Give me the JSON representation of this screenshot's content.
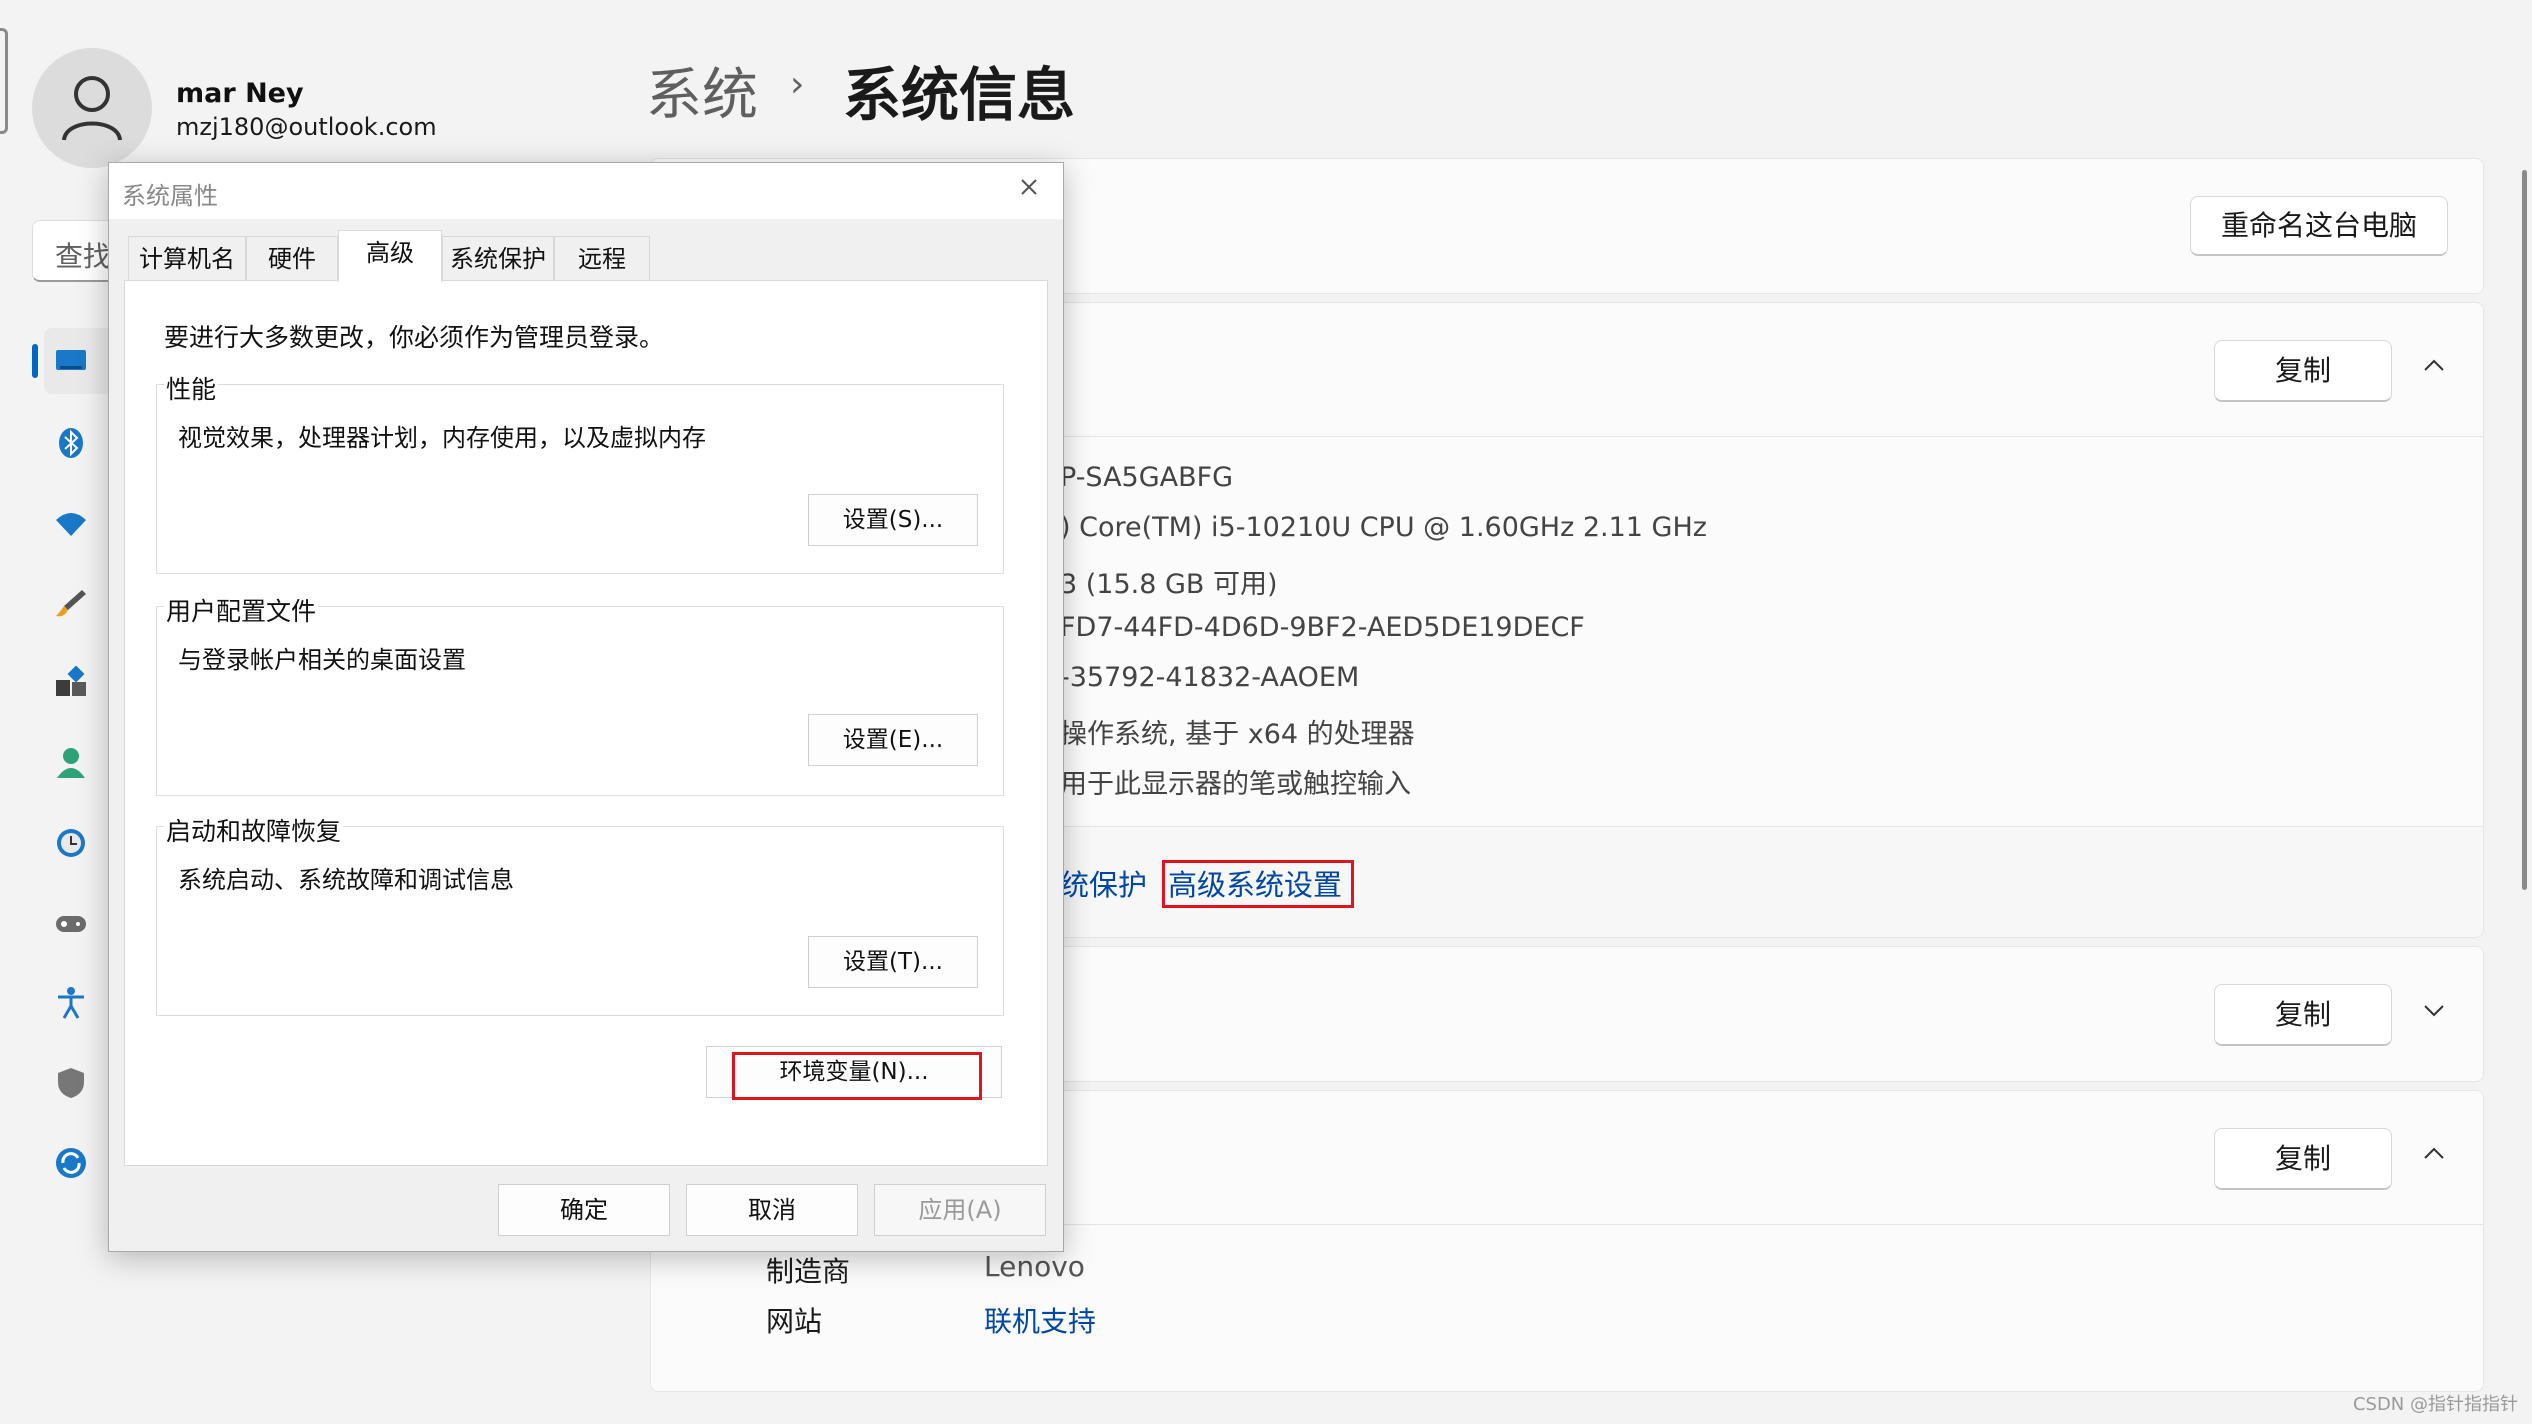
{
  "user": {
    "name": "mar Ney",
    "email": "mzj180@outlook.com"
  },
  "breadcrumb": {
    "root": "系统",
    "separator": "›",
    "current": "系统信息"
  },
  "search": {
    "placeholder": "查找"
  },
  "nav_icons": [
    "display-icon",
    "bluetooth-icon",
    "wifi-icon",
    "brush-icon",
    "apps-icon",
    "person-icon",
    "clock-globe-icon",
    "gamepad-icon",
    "accessibility-icon",
    "shield-icon",
    "update-icon"
  ],
  "rename_card": {
    "button": "重命名这台电脑"
  },
  "device_card": {
    "copy_button": "复制",
    "specs": [
      "P-SA5GABFG",
      ") Core(TM) i5-10210U CPU @ 1.60GHz   2.11 GHz",
      "3 (15.8 GB 可用)",
      "FD7-44FD-4D6D-9BF2-AED5DE19DECF",
      "-35792-41832-AAOEM",
      "操作系统, 基于 x64 的处理器",
      "用于此显示器的笔或触控输入"
    ],
    "links": {
      "protection": "统保护",
      "advanced": "高级系统设置"
    }
  },
  "windows_card": {
    "copy_button": "复制"
  },
  "support_card": {
    "copy_button": "复制",
    "rows": [
      {
        "label": "制造商",
        "value": "Lenovo"
      },
      {
        "label": "网站",
        "value": "联机支持"
      }
    ]
  },
  "dialog": {
    "title": "系统属性",
    "tabs": [
      "计算机名",
      "硬件",
      "高级",
      "系统保护",
      "远程"
    ],
    "admin_note": "要进行大多数更改，你必须作为管理员登录。",
    "groups": {
      "performance": {
        "title": "性能",
        "description": "视觉效果，处理器计划，内存使用，以及虚拟内存",
        "button": "设置(S)..."
      },
      "profile": {
        "title": "用户配置文件",
        "description": "与登录帐户相关的桌面设置",
        "button": "设置(E)..."
      },
      "startup": {
        "title": "启动和故障恢复",
        "description": "系统启动、系统故障和调试信息",
        "button": "设置(T)..."
      }
    },
    "env_button": "环境变量(N)...",
    "ok": "确定",
    "cancel": "取消",
    "apply": "应用(A)"
  },
  "watermark": "CSDN @指针指指针",
  "colors": {
    "accent": "#0067c0",
    "highlight": "#e0141e",
    "link": "#0046a8"
  }
}
